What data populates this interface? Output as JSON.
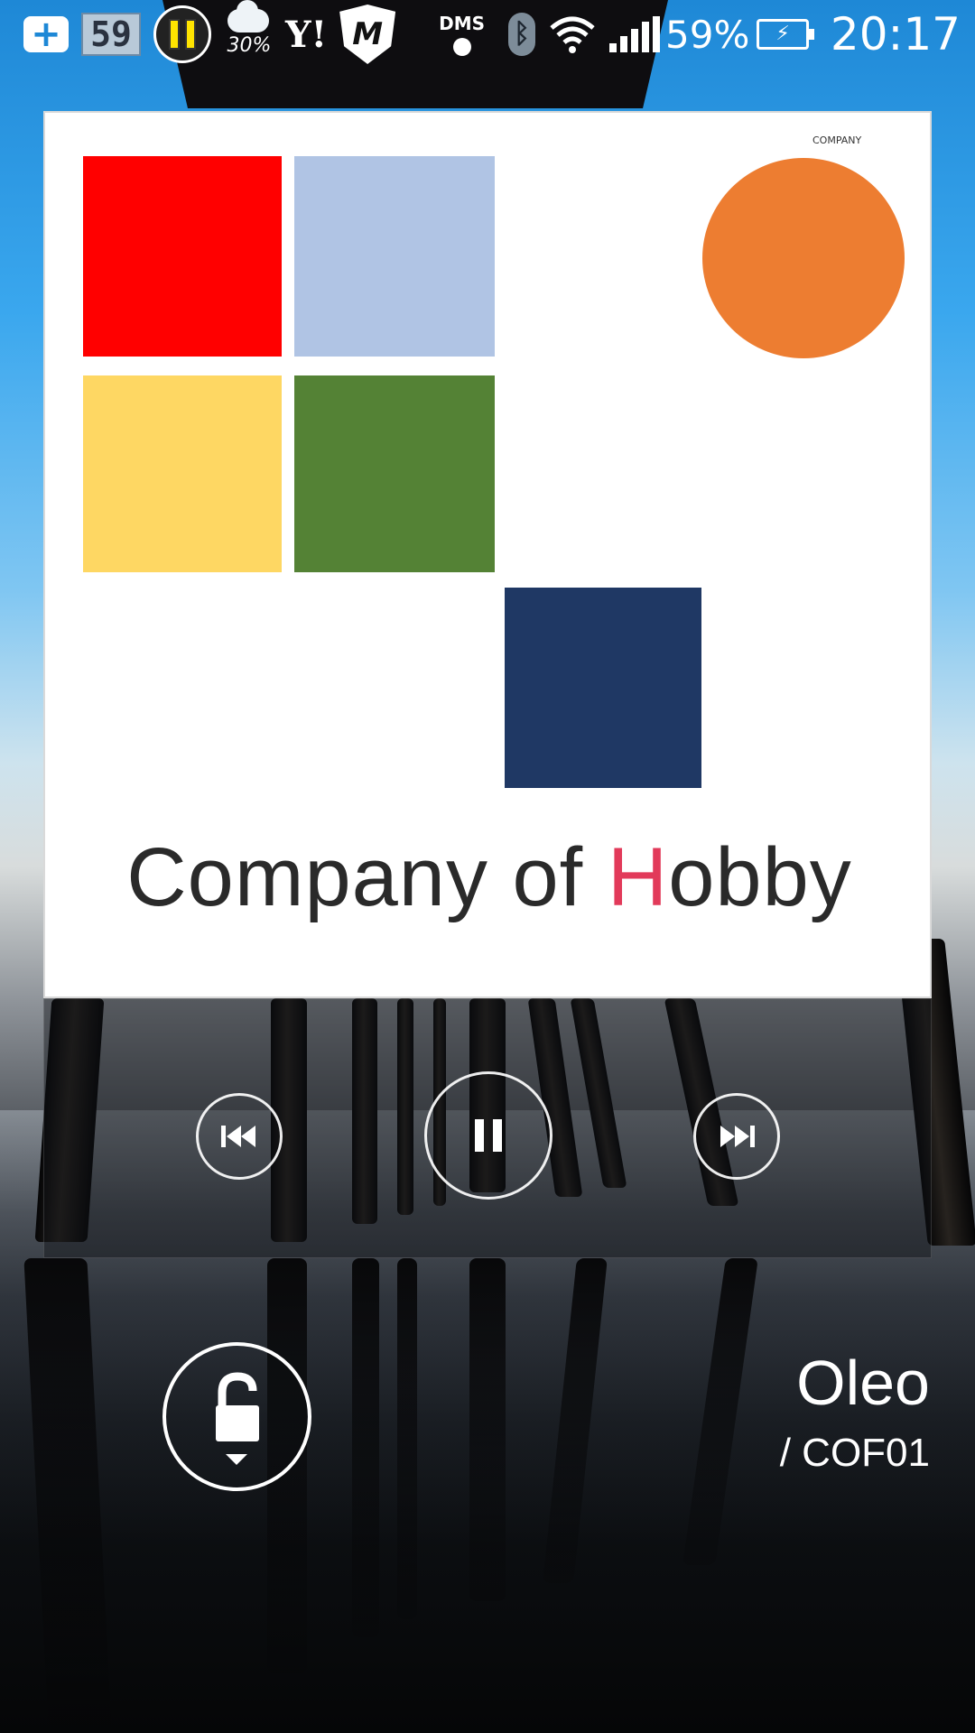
{
  "status_bar": {
    "notification_counter": "59",
    "weather_percent": "30%",
    "yahoo_label": "Y!",
    "shield_letter": "M",
    "dms_label": "DMS",
    "bluetooth_glyph": "ᛒ",
    "battery_percent": "59%",
    "time": "20:17"
  },
  "album_art": {
    "corner_text": "COMPANY",
    "brand_prefix": "Company of ",
    "brand_accent": "H",
    "brand_suffix": "obby",
    "colors": {
      "red": "#ff0000",
      "light_blue": "#b0c4e4",
      "yellow": "#fed763",
      "green": "#548235",
      "navy": "#1f3864",
      "orange": "#ed7d31",
      "accent_text": "#e23a5a"
    }
  },
  "player": {
    "previous_icon": "skip-previous-icon",
    "pause_icon": "pause-icon",
    "next_icon": "skip-next-icon"
  },
  "lockscreen": {
    "unlock_icon": "unlock-icon"
  },
  "track": {
    "title": "Oleo",
    "album": "/ COF01"
  }
}
